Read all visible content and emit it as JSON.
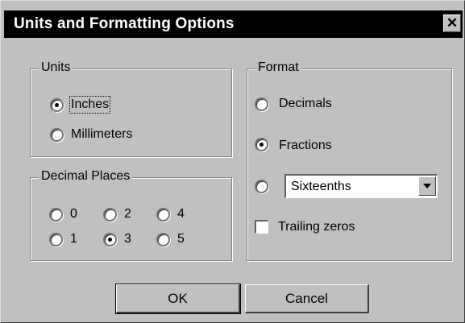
{
  "window": {
    "title": "Units and Formatting Options",
    "close_glyph": "✕"
  },
  "units": {
    "legend": "Units",
    "options": [
      {
        "label": "Inches",
        "checked": true
      },
      {
        "label": "Millimeters",
        "checked": false
      }
    ]
  },
  "decimal_places": {
    "legend": "Decimal Places",
    "options": [
      {
        "label": "0",
        "checked": false
      },
      {
        "label": "1",
        "checked": false
      },
      {
        "label": "2",
        "checked": false
      },
      {
        "label": "3",
        "checked": true
      },
      {
        "label": "4",
        "checked": false
      },
      {
        "label": "5",
        "checked": false
      }
    ]
  },
  "format": {
    "legend": "Format",
    "decimals_label": "Decimals",
    "fractions_label": "Fractions",
    "fraction_select_value": "Sixteenths",
    "trailing_zeros_label": "Trailing zeros",
    "selected": "fractions",
    "trailing_zeros_checked": false
  },
  "buttons": {
    "ok": "OK",
    "cancel": "Cancel"
  }
}
